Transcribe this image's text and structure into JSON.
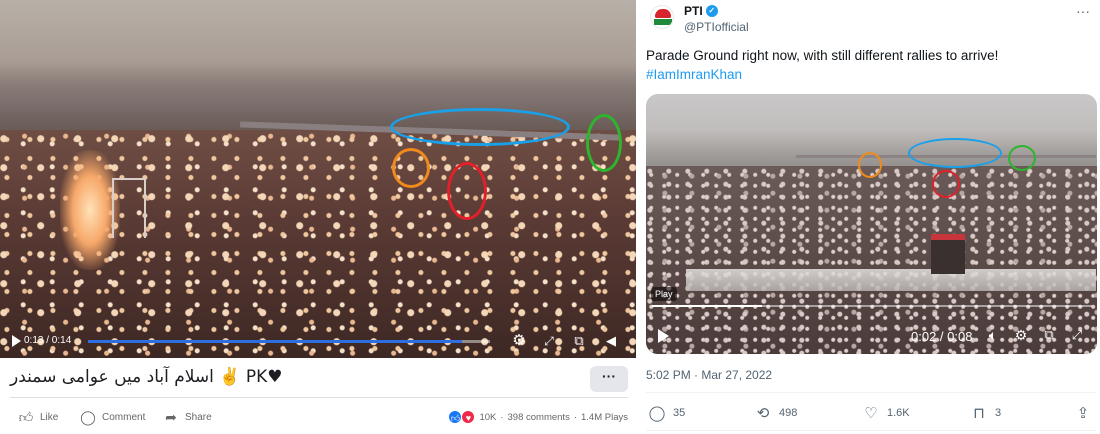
{
  "facebook_post": {
    "video": {
      "time": "0:13 / 0:14",
      "progress_fraction": 0.93
    },
    "caption": "اسلام آباد میں عوامی سمندر ✌️ PK♥",
    "more_label": "···",
    "actions": {
      "like": "Like",
      "comment": "Comment",
      "share": "Share"
    },
    "stats": {
      "reactions": "10K",
      "comments": "398 comments",
      "plays": "1.4M Plays",
      "separator": "·"
    }
  },
  "twitter_post": {
    "author_name": "PTI",
    "handle": "@PTIofficial",
    "text": "Parade Ground right now, with still different rallies to arrive!",
    "hashtag": "#IamImranKhan",
    "video": {
      "play_tag": "Play",
      "time": "0:02 / 0:08",
      "progress_fraction": 0.25
    },
    "date": "5:02 PM · Mar 27, 2022",
    "stats": {
      "replies": "35",
      "retweets": "498",
      "likes": "1.6K",
      "bookmarks": "3"
    }
  },
  "annotation_colors": {
    "blue": "#1aa0e8",
    "orange": "#f08a1c",
    "red": "#e2202a",
    "green": "#2eb52e"
  }
}
